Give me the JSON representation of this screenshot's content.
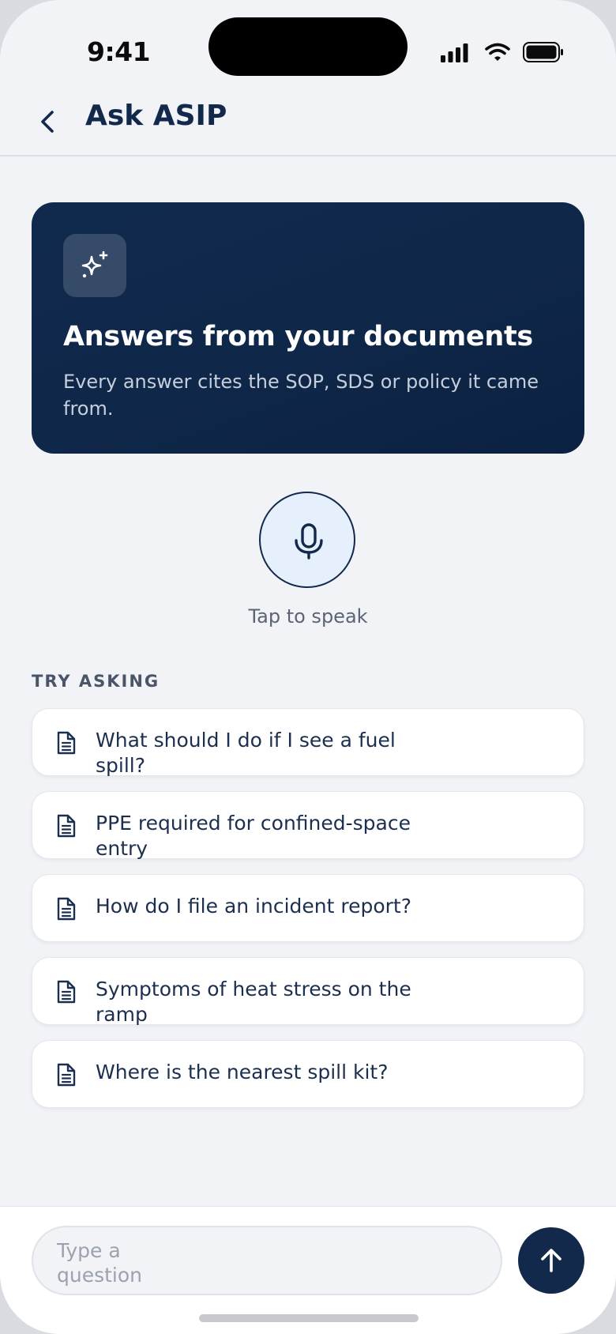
{
  "status_bar": {
    "time": "9:41"
  },
  "nav": {
    "title": "Ask ASIP"
  },
  "hero": {
    "icon": "sparkles-icon",
    "title": "Answers from your documents",
    "subtitle": "Every answer cites the SOP, SDS or policy it came from."
  },
  "voice": {
    "label": "Tap to speak",
    "icon": "microphone-icon"
  },
  "suggestions": {
    "heading": "TRY ASKING",
    "items": [
      {
        "label": "What should I do if I see a fuel spill?"
      },
      {
        "label": "PPE required for confined-space entry"
      },
      {
        "label": "How do I file an incident report?"
      },
      {
        "label": "Symptoms of heat stress on the ramp"
      },
      {
        "label": "Where is the nearest spill kit?"
      }
    ]
  },
  "composer": {
    "placeholder": "Type a question",
    "value": "",
    "send_icon": "arrow-up-icon"
  },
  "colors": {
    "brand": "#13294b",
    "hero_bg": "#0f2748",
    "background": "#f2f3f7"
  }
}
